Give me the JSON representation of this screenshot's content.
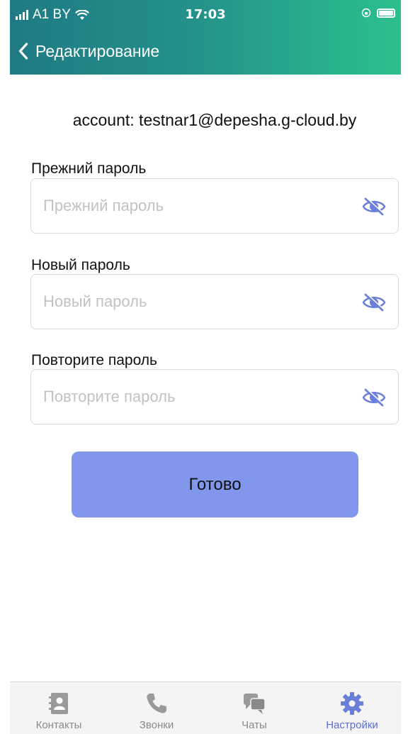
{
  "status_bar": {
    "carrier": "A1 BY",
    "time": "17:03"
  },
  "nav": {
    "title": "Редактирование"
  },
  "account_text": "account: testnar1@depesha.g-cloud.by",
  "fields": [
    {
      "label": "Прежний пароль",
      "placeholder": "Прежний пароль",
      "value": ""
    },
    {
      "label": "Новый пароль",
      "placeholder": "Новый пароль",
      "value": ""
    },
    {
      "label": "Повторите пароль",
      "placeholder": "Повторите пароль",
      "value": ""
    }
  ],
  "done_button": {
    "label": "Готово"
  },
  "tabbar": {
    "items": [
      {
        "label": "Контакты",
        "icon": "contacts-icon",
        "active": false
      },
      {
        "label": "Звонки",
        "icon": "phone-icon",
        "active": false
      },
      {
        "label": "Чаты",
        "icon": "chats-icon",
        "active": false
      },
      {
        "label": "Настройки",
        "icon": "gear-icon",
        "active": true
      }
    ]
  },
  "colors": {
    "header_start": "#1f7a84",
    "header_end": "#2cbf8e",
    "button": "#8097eb",
    "tab_active": "#5a6fd6",
    "tab_inactive": "#8a8a8a"
  }
}
